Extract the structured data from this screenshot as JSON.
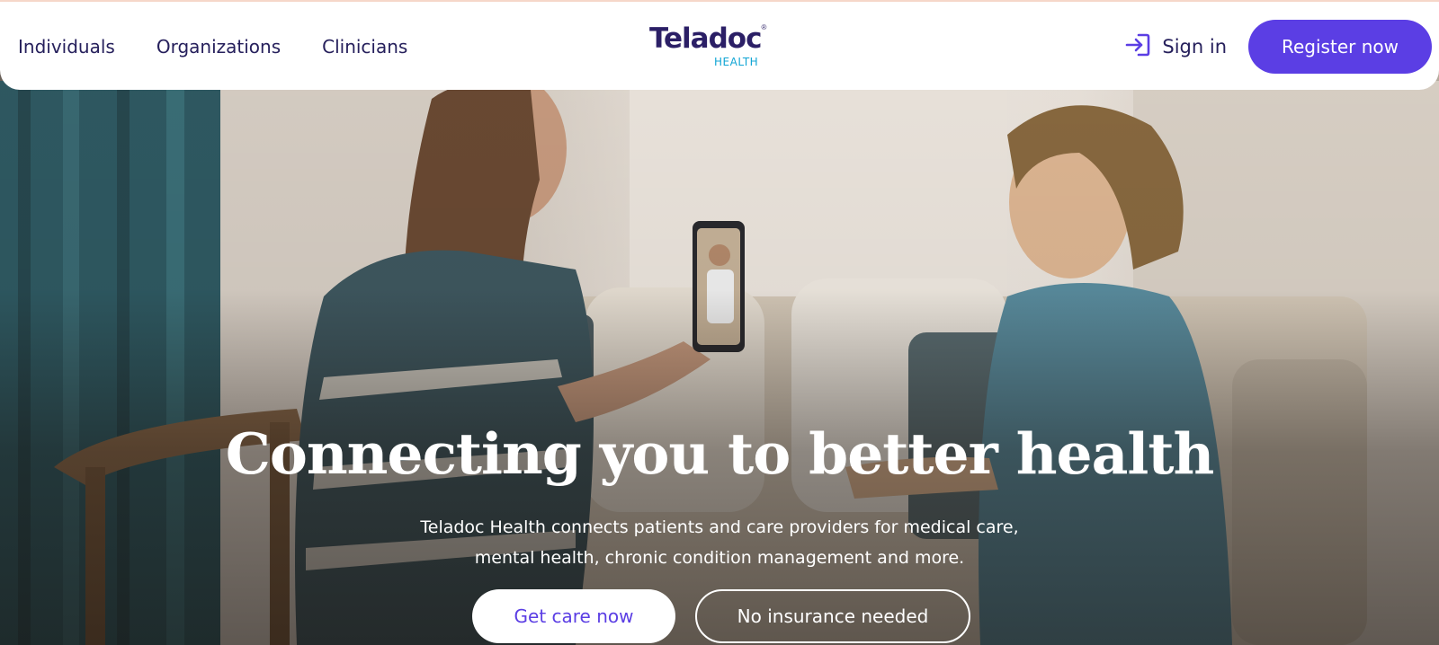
{
  "nav": {
    "left_links": [
      "Individuals",
      "Organizations",
      "Clinicians"
    ],
    "sign_in_label": "Sign in",
    "register_label": "Register now"
  },
  "logo": {
    "word": "Teladoc",
    "registered_mark": "®",
    "sub": "HEALTH"
  },
  "hero": {
    "headline": "Connecting you to better health",
    "subtext_line1": "Teladoc Health connects patients and care providers for medical care,",
    "subtext_line2": "mental health, chronic condition management and more.",
    "primary_cta": "Get care now",
    "secondary_cta": "No insurance needed"
  },
  "colors": {
    "brand_purple": "#5b3ee4",
    "navy_text": "#26205c",
    "logo_navy": "#2b1f66",
    "logo_cyan": "#10a5d4"
  },
  "icons": {
    "sign_in": "sign-in-arrow-icon"
  }
}
